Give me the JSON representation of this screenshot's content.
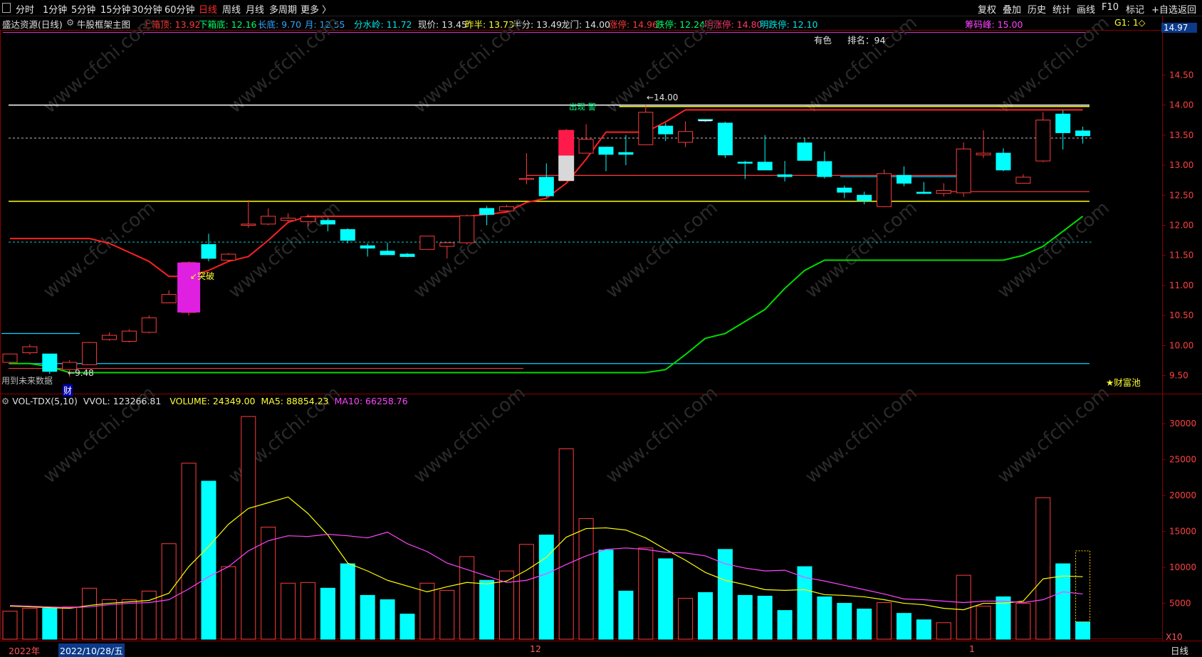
{
  "topbar": {
    "left_items": [
      "分时",
      "1分钟",
      "5分钟",
      "15分钟",
      "30分钟",
      "60分钟",
      "日线",
      "周线",
      "月线",
      "多周期",
      "更多 〉"
    ],
    "active": "日线",
    "right_items": [
      "复权",
      "叠加",
      "历史",
      "统计",
      "画线",
      "F10",
      "标记",
      "+自选",
      "返回"
    ]
  },
  "info": {
    "stock": "盛达资源(日线)",
    "indicator": "牛股框架主图",
    "upper_box": "上箱顶: 13.92",
    "lower_box": "下箱底: 12.16",
    "long_bottom": "长底: 9.70",
    "month": "月: 12.55",
    "watershed": "分水岭: 11.72",
    "price": "现价: 13.45",
    "prev_half": "昨半: 13.73",
    "half": "半分: 13.49",
    "dragon_gate": "龙门: 14.00",
    "limit_up": "涨停: 14.96",
    "limit_down": "跌停: 12.24",
    "next_up": "明涨停: 14.80",
    "next_down": "明跌停: 12.10",
    "chip_peak": "筹码峰: 15.00",
    "g1": "G1: 1◇"
  },
  "annotations": {
    "sector": "有色",
    "rank": "排名：94",
    "high_marker": "14.00",
    "low_marker": "9.48",
    "breakout": "突破",
    "signal": "出现 警",
    "future_data": "用到未来数据",
    "cai": "财",
    "wealth_pool": "★财富池",
    "price_box": "14.97"
  },
  "volume_info": {
    "name": "VOL-TDX(5,10)",
    "vvol": "VVOL: 123266.81",
    "volume": "VOLUME: 24349.00",
    "ma5": "MA5: 88854.23",
    "ma10": "MA10: 66258.76",
    "unit": "X10"
  },
  "bottom_bar": {
    "year": "2022年",
    "date": "2022/10/28/五",
    "m12": "12",
    "m1": "1",
    "period": "日线"
  },
  "colors": {
    "up": "#ff3b3b",
    "down": "#00ffff",
    "ma5": "#ffff00",
    "ma10": "#ff44ff",
    "support": "#00dd00",
    "upper_line": "#ffff00",
    "accent": "#ff2b2b"
  },
  "chart_data": {
    "type": "candlestick",
    "price_axis": {
      "ylim": [
        9.2,
        15.25
      ],
      "ticks": [
        9.5,
        10.0,
        10.5,
        11.0,
        11.5,
        12.0,
        12.5,
        13.0,
        13.5,
        14.0,
        14.5
      ]
    },
    "volume_axis": {
      "ylim": [
        0,
        32500
      ],
      "ticks": [
        5000,
        10000,
        15000,
        20000,
        25000,
        30000
      ]
    },
    "candles": [
      {
        "o": 9.72,
        "h": 9.82,
        "l": 9.7,
        "c": 9.86
      },
      {
        "o": 9.88,
        "h": 10.02,
        "l": 9.85,
        "c": 9.98
      },
      {
        "o": 9.86,
        "h": 9.86,
        "l": 9.53,
        "c": 9.57
      },
      {
        "o": 9.6,
        "h": 9.76,
        "l": 9.48,
        "c": 9.72
      },
      {
        "o": 9.68,
        "h": 10.06,
        "l": 9.68,
        "c": 10.05
      },
      {
        "o": 10.1,
        "h": 10.22,
        "l": 10.08,
        "c": 10.17
      },
      {
        "o": 10.07,
        "h": 10.27,
        "l": 10.05,
        "c": 10.24
      },
      {
        "o": 10.22,
        "h": 10.5,
        "l": 10.2,
        "c": 10.46
      },
      {
        "o": 10.71,
        "h": 10.92,
        "l": 10.71,
        "c": 10.85
      },
      {
        "o": 10.55,
        "h": 11.4,
        "l": 10.5,
        "c": 11.38
      },
      {
        "o": 11.68,
        "h": 11.86,
        "l": 11.4,
        "c": 11.45
      },
      {
        "o": 11.42,
        "h": 11.54,
        "l": 11.4,
        "c": 11.52
      },
      {
        "o": 12.0,
        "h": 12.42,
        "l": 11.96,
        "c": 12.02
      },
      {
        "o": 12.02,
        "h": 12.28,
        "l": 12.0,
        "c": 12.15
      },
      {
        "o": 12.08,
        "h": 12.2,
        "l": 12.06,
        "c": 12.12
      },
      {
        "o": 12.06,
        "h": 12.18,
        "l": 11.98,
        "c": 12.14
      },
      {
        "o": 12.08,
        "h": 12.11,
        "l": 11.9,
        "c": 12.02
      },
      {
        "o": 11.93,
        "h": 11.95,
        "l": 11.7,
        "c": 11.75
      },
      {
        "o": 11.66,
        "h": 11.7,
        "l": 11.48,
        "c": 11.62
      },
      {
        "o": 11.57,
        "h": 11.71,
        "l": 11.52,
        "c": 11.51
      },
      {
        "o": 11.52,
        "h": 11.54,
        "l": 11.47,
        "c": 11.48
      },
      {
        "o": 11.6,
        "h": 11.76,
        "l": 11.6,
        "c": 11.82
      },
      {
        "o": 11.65,
        "h": 11.72,
        "l": 11.45,
        "c": 11.71
      },
      {
        "o": 11.71,
        "h": 12.18,
        "l": 11.68,
        "c": 12.16
      },
      {
        "o": 12.28,
        "h": 12.32,
        "l": 12.0,
        "c": 12.18
      },
      {
        "o": 12.24,
        "h": 12.34,
        "l": 12.22,
        "c": 12.31
      },
      {
        "o": 12.78,
        "h": 13.2,
        "l": 12.68,
        "c": 12.78
      },
      {
        "o": 12.8,
        "h": 13.03,
        "l": 12.47,
        "c": 12.49
      },
      {
        "o": 12.74,
        "h": 13.6,
        "l": 12.74,
        "c": 13.58
      },
      {
        "o": 13.2,
        "h": 13.68,
        "l": 13.2,
        "c": 13.43
      },
      {
        "o": 13.3,
        "h": 13.31,
        "l": 12.9,
        "c": 13.18
      },
      {
        "o": 13.21,
        "h": 13.5,
        "l": 13.0,
        "c": 13.18
      },
      {
        "o": 13.34,
        "h": 14.0,
        "l": 13.34,
        "c": 13.88
      },
      {
        "o": 13.65,
        "h": 13.7,
        "l": 13.4,
        "c": 13.52
      },
      {
        "o": 13.38,
        "h": 13.73,
        "l": 13.3,
        "c": 13.56
      },
      {
        "o": 13.76,
        "h": 13.75,
        "l": 13.72,
        "c": 13.74
      },
      {
        "o": 13.7,
        "h": 13.72,
        "l": 13.12,
        "c": 13.17
      },
      {
        "o": 13.05,
        "h": 13.07,
        "l": 12.77,
        "c": 13.04
      },
      {
        "o": 13.05,
        "h": 13.5,
        "l": 12.98,
        "c": 12.92
      },
      {
        "o": 12.84,
        "h": 13.07,
        "l": 12.73,
        "c": 12.81
      },
      {
        "o": 13.37,
        "h": 13.45,
        "l": 13.1,
        "c": 13.08
      },
      {
        "o": 13.06,
        "h": 13.23,
        "l": 12.78,
        "c": 12.81
      },
      {
        "o": 12.62,
        "h": 12.66,
        "l": 12.45,
        "c": 12.55
      },
      {
        "o": 12.5,
        "h": 12.56,
        "l": 12.35,
        "c": 12.41
      },
      {
        "o": 12.31,
        "h": 12.93,
        "l": 12.3,
        "c": 12.86
      },
      {
        "o": 12.83,
        "h": 12.98,
        "l": 12.65,
        "c": 12.7
      },
      {
        "o": 12.55,
        "h": 12.72,
        "l": 12.52,
        "c": 12.53
      },
      {
        "o": 12.53,
        "h": 12.7,
        "l": 12.48,
        "c": 12.58
      },
      {
        "o": 12.54,
        "h": 13.38,
        "l": 12.47,
        "c": 13.27
      },
      {
        "o": 13.17,
        "h": 13.58,
        "l": 13.12,
        "c": 13.2
      },
      {
        "o": 13.2,
        "h": 13.28,
        "l": 12.9,
        "c": 12.92
      },
      {
        "o": 12.7,
        "h": 12.85,
        "l": 12.7,
        "c": 12.8
      },
      {
        "o": 13.07,
        "h": 13.88,
        "l": 13.05,
        "c": 13.75
      },
      {
        "o": 13.85,
        "h": 13.91,
        "l": 13.26,
        "c": 13.54
      },
      {
        "o": 13.57,
        "h": 13.64,
        "l": 13.36,
        "c": 13.49
      }
    ],
    "volumes": [
      3900,
      4300,
      4300,
      4500,
      7100,
      5500,
      5500,
      6700,
      13300,
      24500,
      22000,
      10100,
      31000,
      15600,
      7800,
      7900,
      7100,
      10500,
      6100,
      5500,
      3500,
      7800,
      6800,
      11500,
      8200,
      9500,
      13200,
      14500,
      26500,
      16800,
      12400,
      6700,
      12700,
      11200,
      5700,
      6500,
      12500,
      6100,
      6000,
      4000,
      10100,
      5900,
      5000,
      4200,
      5100,
      3600,
      2700,
      2300,
      8900,
      4600,
      5900,
      5000,
      19700,
      10500,
      2400
    ],
    "ma5": [
      4600,
      4500,
      4400,
      4300,
      4700,
      5000,
      5200,
      5400,
      6400,
      10100,
      12900,
      16000,
      18200,
      19000,
      19800,
      17500,
      14500,
      10600,
      9500,
      8200,
      7400,
      6600,
      7300,
      7900,
      7700,
      8100,
      9600,
      11400,
      14200,
      15400,
      15500,
      15200,
      14100,
      12500,
      11000,
      9300,
      8200,
      7600,
      6900,
      6800,
      6900,
      6200,
      6100,
      5900,
      5500,
      5000,
      4800,
      4300,
      4100,
      5000,
      5000,
      5300,
      8400,
      8800,
      8700
    ],
    "ma10": [
      4700,
      4600,
      4500,
      4400,
      4500,
      4800,
      5000,
      5100,
      5500,
      7000,
      8700,
      10100,
      12300,
      13700,
      14400,
      14300,
      14600,
      14400,
      14100,
      14900,
      13300,
      12200,
      10600,
      9700,
      8800,
      7900,
      8200,
      9100,
      10400,
      11600,
      12500,
      12700,
      12500,
      12100,
      12000,
      11600,
      10500,
      9900,
      9500,
      9600,
      8600,
      8100,
      7500,
      6900,
      6300,
      5600,
      5500,
      5300,
      5100,
      5300,
      5300,
      5100,
      5500,
      6600,
      6300
    ],
    "lines": {
      "upper_white": 14.0,
      "upper_yellow": 12.4,
      "cyan_long_bottom": 9.7,
      "cyan_upper_left": 10.2,
      "dashed_current": 13.45,
      "dashed_watershed": 11.72
    },
    "red_stair": [
      11.78,
      11.78,
      11.78,
      11.78,
      11.78,
      11.7,
      11.55,
      11.4,
      11.15,
      11.15,
      11.25,
      11.4,
      11.48,
      11.75,
      12.05,
      12.15,
      12.15,
      12.15,
      12.15,
      12.15,
      12.15,
      12.15,
      12.15,
      12.15,
      12.18,
      12.22,
      12.38,
      12.45,
      12.7,
      13.1,
      13.55,
      13.55,
      13.55,
      13.72,
      13.92,
      13.92,
      13.92,
      13.92,
      13.92,
      13.92,
      13.92,
      13.92,
      13.92,
      13.92,
      13.92,
      13.92,
      13.92,
      13.92,
      13.92,
      13.92,
      13.92,
      13.92,
      13.92,
      13.92,
      13.92
    ],
    "green_support": [
      9.7,
      9.7,
      9.65,
      9.55,
      9.55,
      9.55,
      9.55,
      9.55,
      9.55,
      9.55,
      9.55,
      9.55,
      9.55,
      9.55,
      9.55,
      9.55,
      9.55,
      9.55,
      9.55,
      9.55,
      9.55,
      9.55,
      9.55,
      9.55,
      9.55,
      9.55,
      9.55,
      9.55,
      9.55,
      9.55,
      9.55,
      9.55,
      9.55,
      9.6,
      9.85,
      10.12,
      10.2,
      10.4,
      10.6,
      10.95,
      11.25,
      11.42,
      11.42,
      11.42,
      11.42,
      11.42,
      11.42,
      11.42,
      11.42,
      11.42,
      11.42,
      11.5,
      11.65,
      11.9,
      12.15
    ]
  }
}
